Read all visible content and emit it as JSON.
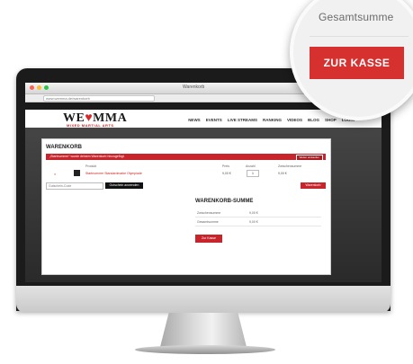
{
  "browser": {
    "tab_title": "Warenkorb",
    "address": "www.wemma.de/warenkorb"
  },
  "site": {
    "topbar_login": "Login",
    "logo_text_left": "WE",
    "logo_heart": "♥",
    "logo_text_right": "MMA",
    "logo_sub": "MIXED MARTIAL ARTS",
    "nav": [
      "NEWS",
      "EVENTS",
      "LIVE STREAMS",
      "RANKING",
      "VIDEOS",
      "BLOG",
      "SHOP",
      "LOGIN"
    ]
  },
  "cart": {
    "title": "WARENKORB",
    "notice": "„Startnummer“ wurde deinem Warenkorb hinzugefügt.",
    "notice_button": "Weiter einkaufen",
    "headers": {
      "product": "Produkt",
      "price": "Preis",
      "quantity": "Anzahl",
      "total": "Zwischensumme"
    },
    "item": {
      "remove": "×",
      "name": "Startnummer Standardmarke Olympiade",
      "price": "9,00 €",
      "qty": "1",
      "total": "9,00 €"
    },
    "coupon_placeholder": "Gutschein-Code",
    "coupon_button": "Gutschein anwenden",
    "update_button": "Warenkorb aktualisieren"
  },
  "totals": {
    "title": "WARENKORB-SUMME",
    "rows": [
      {
        "label": "Zwischensumme",
        "value": "9,00 €"
      },
      {
        "label": "Gesamtsumme",
        "value": "9,00 €"
      }
    ],
    "checkout_small": "Zur Kasse"
  },
  "zoom": {
    "label": "Gesamtsumme",
    "button": "ZUR KASSE"
  },
  "colors": {
    "accent": "#d6302f",
    "dark": "#1b1b1b"
  }
}
